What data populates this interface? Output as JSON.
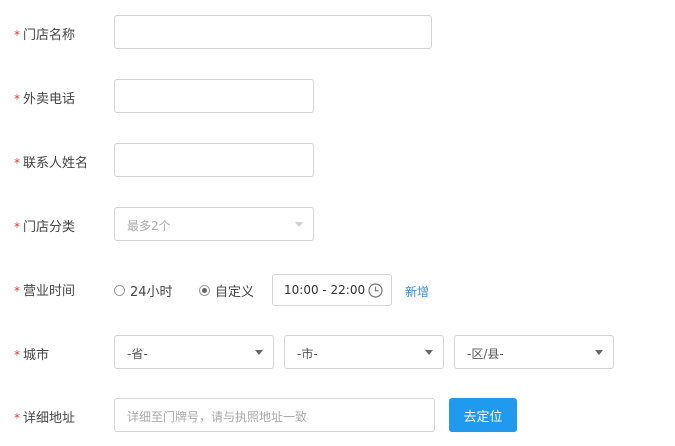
{
  "form": {
    "required_mark": "*",
    "store_name": {
      "label": "门店名称",
      "value": ""
    },
    "takeout_phone": {
      "label": "外卖电话",
      "value": ""
    },
    "contact_name": {
      "label": "联系人姓名",
      "value": ""
    },
    "category": {
      "label": "门店分类",
      "placeholder": "最多2个"
    },
    "hours": {
      "label": "营业时间",
      "option_24h": "24小时",
      "option_custom": "自定义",
      "selected": "自定义",
      "time_range": "10:00 - 22:00",
      "add_link": "新增"
    },
    "city": {
      "label": "城市",
      "province": "-省-",
      "city": "-市-",
      "district": "-区/县-"
    },
    "address": {
      "label": "详细地址",
      "placeholder": "详细至门牌号，请与执照地址一致",
      "locate_button": "去定位"
    }
  }
}
